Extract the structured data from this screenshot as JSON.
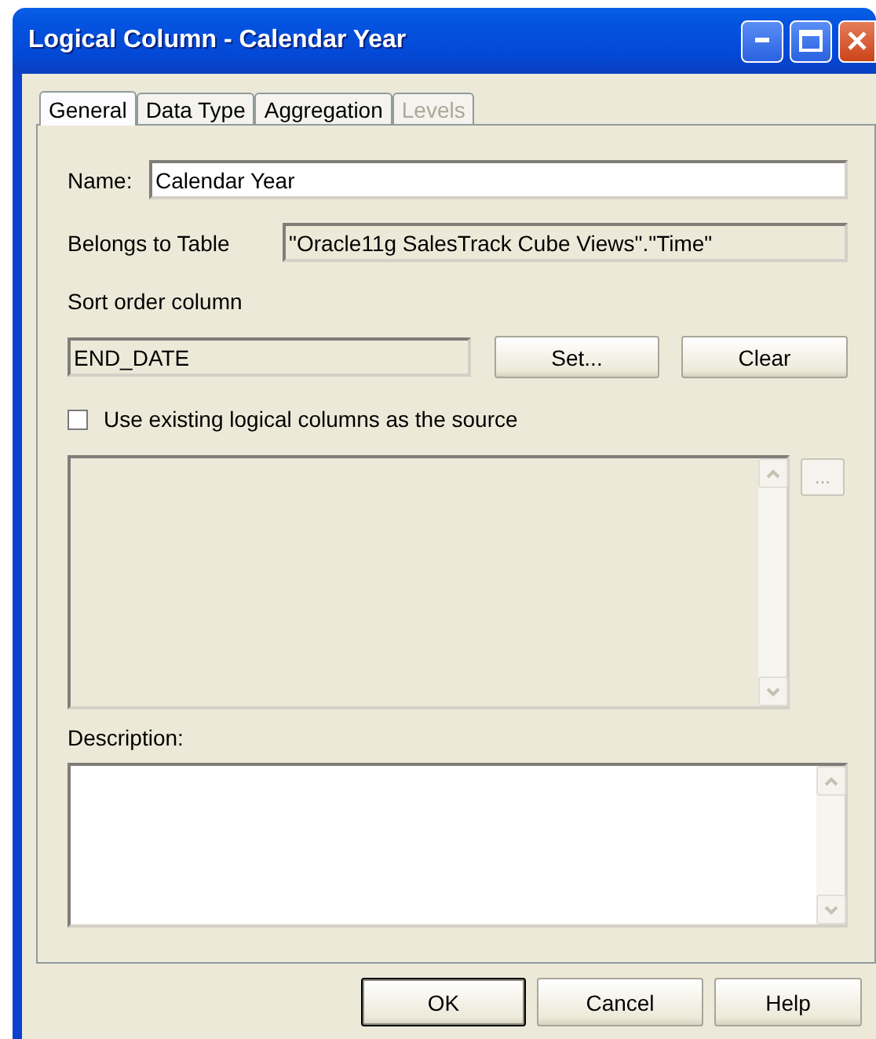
{
  "window": {
    "title": "Logical Column - Calendar Year"
  },
  "tabs": [
    {
      "label": "General",
      "selected": true,
      "disabled": false
    },
    {
      "label": "Data Type",
      "selected": false,
      "disabled": false
    },
    {
      "label": "Aggregation",
      "selected": false,
      "disabled": false
    },
    {
      "label": "Levels",
      "selected": false,
      "disabled": true
    }
  ],
  "name": {
    "label": "Name:",
    "value": "Calendar Year"
  },
  "table": {
    "label": "Belongs to Table",
    "value": "\"Oracle11g SalesTrack Cube Views\".\"Time\""
  },
  "sort_order": {
    "label": "Sort order column",
    "value": "END_DATE",
    "buttons": [
      "Set...",
      "Clear"
    ]
  },
  "source_checkbox": {
    "label": "Use existing logical columns as the source",
    "checked": false
  },
  "source_list": {
    "disabled": true,
    "browse_button": "..."
  },
  "description": {
    "label": "Description:"
  },
  "buttons": [
    {
      "label": "OK",
      "default": true
    },
    {
      "label": "Cancel",
      "default": false
    },
    {
      "label": "Help",
      "default": false
    }
  ]
}
